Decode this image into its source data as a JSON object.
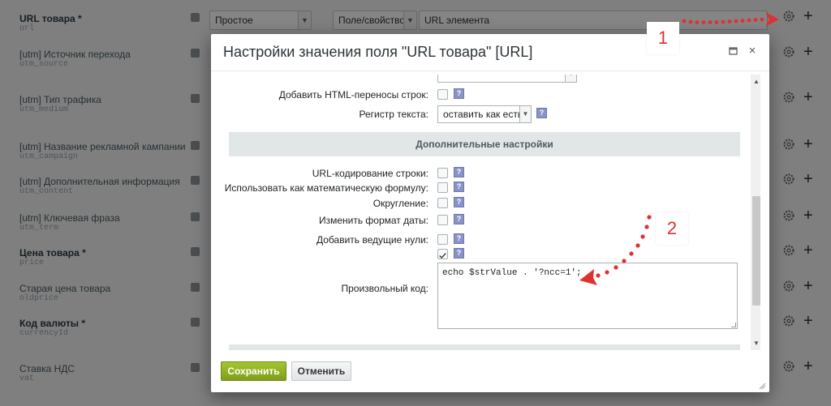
{
  "background": {
    "rows": [
      {
        "label": "URL товара *",
        "code": "url",
        "bold": true
      },
      {
        "label": "[utm] Источник перехода",
        "code": "utm_source",
        "bold": false
      },
      {
        "label": "[utm] Тип трафика",
        "code": "utm_medium",
        "bold": false
      },
      {
        "label": "[utm] Название рекламной кампании",
        "code": "utm_campaign",
        "bold": false
      },
      {
        "label": "[utm] Дополнительная информация",
        "code": "utm_content",
        "bold": false
      },
      {
        "label": "[utm] Ключевая фраза",
        "code": "utm_term",
        "bold": false
      },
      {
        "label": "Цена товара *",
        "code": "price",
        "bold": true
      },
      {
        "label": "Старая цена товара",
        "code": "oldprice",
        "bold": false
      },
      {
        "label": "Код валюты *",
        "code": "currencyId",
        "bold": true
      },
      {
        "label": "Ставка НДС",
        "code": "vat",
        "bold": false
      }
    ],
    "top_select_type": "Простое",
    "top_select_source": "Поле/свойство",
    "top_select_value": "URL элемента",
    "gear_icon": "gear-icon",
    "plus_icon": "plus-icon",
    "plus_label": "+"
  },
  "dialog": {
    "title": "Настройки значения поля \"URL товара\" [URL]",
    "max_icon": "maximize-icon",
    "close_icon": "close-icon",
    "close_label": "×",
    "fields_top": [
      {
        "label": "Добавить HTML-переносы строк:",
        "type": "checkbox",
        "checked": false
      }
    ],
    "text_case": {
      "label": "Регистр текста:",
      "value": "оставить как есть"
    },
    "section_title": "Дополнительные настройки",
    "fields_extra": [
      {
        "label": "URL-кодирование строки:",
        "checked": false
      },
      {
        "label": "Использовать как математическую формулу:",
        "checked": false
      },
      {
        "label": "Округление:",
        "checked": false
      },
      {
        "label": "Изменить формат даты:",
        "checked": false
      },
      {
        "label": "Добавить ведущие нули:",
        "checked": false
      },
      {
        "label": "",
        "checked": true
      }
    ],
    "custom_code": {
      "label": "Произвольный код:",
      "value": "echo $strValue . '?ncc=1';"
    },
    "help_label": "?",
    "save_label": "Сохранить",
    "cancel_label": "Отменить"
  },
  "annotations": {
    "badge1": "1",
    "badge2": "2",
    "color": "#e03131"
  }
}
